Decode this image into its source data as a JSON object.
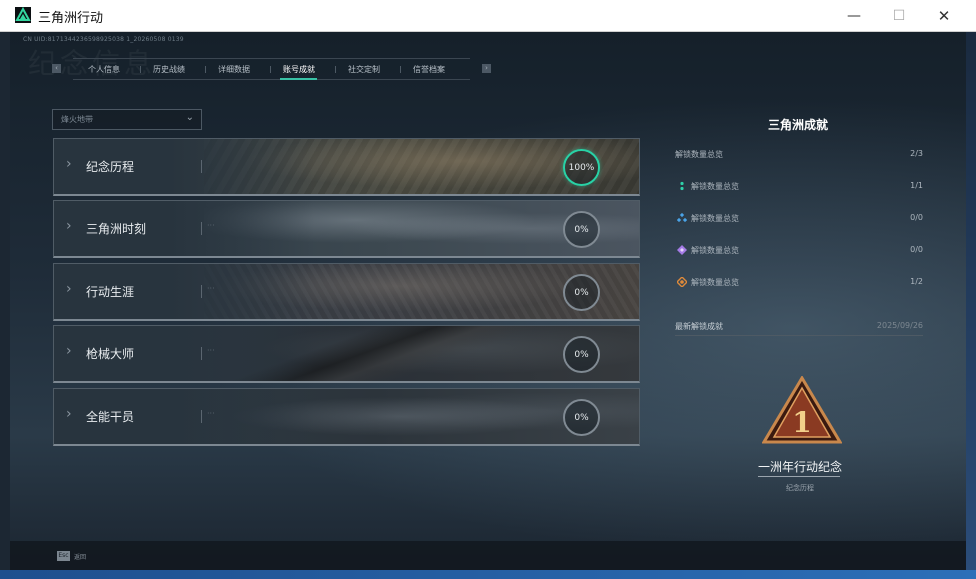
{
  "window": {
    "title": "三角洲行动",
    "minimize_glyph": "—",
    "maximize_glyph": "☐",
    "close_glyph": "✕"
  },
  "header": {
    "uid": "CN UID:8171344236598925038 1_20260508 0139",
    "watermark": "纪念信息"
  },
  "tabs": {
    "prev_glyph": "‹",
    "next_glyph": "›",
    "items": [
      {
        "label": "个人信息"
      },
      {
        "label": "历史战绩"
      },
      {
        "label": "详细数据"
      },
      {
        "label": "账号成就",
        "active": true
      },
      {
        "label": "社交定制"
      },
      {
        "label": "信誉档案"
      }
    ]
  },
  "filter": {
    "value": "烽火地带",
    "chevron": "⌄"
  },
  "categories": [
    {
      "label": "纪念历程",
      "progress": "100%"
    },
    {
      "label": "三角洲时刻",
      "progress": "0%"
    },
    {
      "label": "行动生涯",
      "progress": "0%"
    },
    {
      "label": "枪械大师",
      "progress": "0%"
    },
    {
      "label": "全能干员",
      "progress": "0%"
    }
  ],
  "panel": {
    "title": "三角洲成就",
    "total": {
      "label": "解锁数量总览",
      "value": "2/3"
    },
    "stats": [
      {
        "label": "解锁数量总览",
        "value": "1/1",
        "icon": "green-rank-icon",
        "color": "#2fd0a8"
      },
      {
        "label": "解锁数量总览",
        "value": "0/0",
        "icon": "blue-rank-icon",
        "color": "#4aa3e8"
      },
      {
        "label": "解锁数量总览",
        "value": "0/0",
        "icon": "purple-rank-icon",
        "color": "#a57be6"
      },
      {
        "label": "解锁数量总览",
        "value": "1/2",
        "icon": "orange-rank-icon",
        "color": "#e08a3a"
      }
    ],
    "recent": {
      "label": "最新解锁成就",
      "date": "2025/09/26"
    },
    "badge": {
      "number": "1",
      "name": "一洲年行动纪念",
      "category": "纪念历程"
    }
  },
  "footer": {
    "esc_key": "Esc",
    "esc_label": "返回"
  }
}
